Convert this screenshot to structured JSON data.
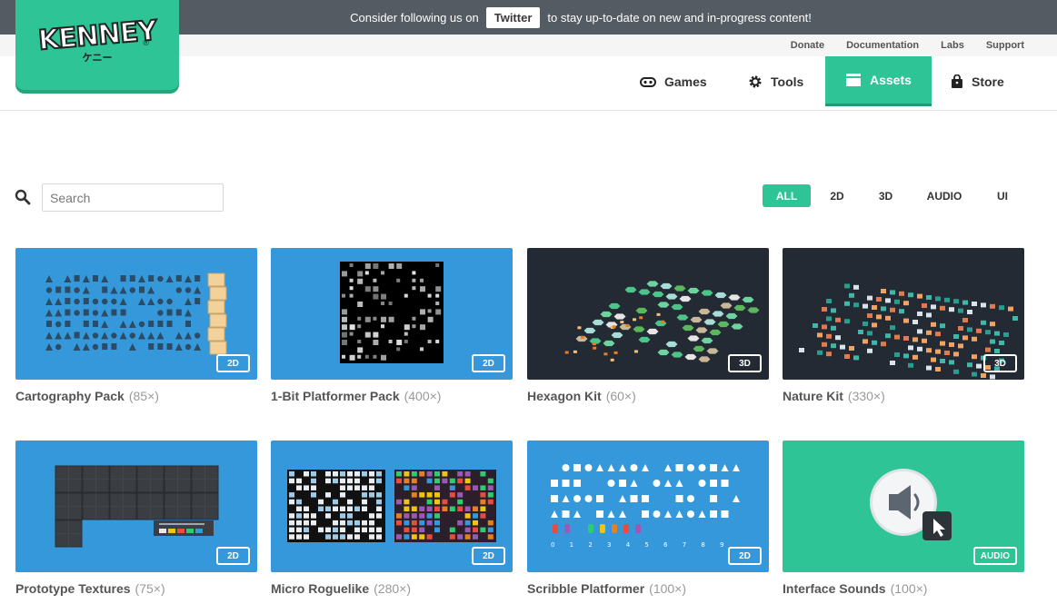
{
  "banner": {
    "text_before": "Consider following us on",
    "button": "Twitter",
    "text_after": "to stay up-to-date on new and in-progress content!"
  },
  "top_links": [
    "Donate",
    "Documentation",
    "Labs",
    "Support"
  ],
  "logo": {
    "word": "KENNEY",
    "kana": "ケニー",
    "reg": "®"
  },
  "nav": [
    {
      "label": "Games",
      "icon": "gamepad-icon"
    },
    {
      "label": "Tools",
      "icon": "gear-icon"
    },
    {
      "label": "Assets",
      "icon": "folder-icon",
      "active": true
    },
    {
      "label": "Store",
      "icon": "bag-icon"
    }
  ],
  "search": {
    "placeholder": "Search",
    "value": ""
  },
  "filters": [
    "ALL",
    "2D",
    "3D",
    "AUDIO",
    "UI"
  ],
  "filter_active": "ALL",
  "assets": [
    {
      "title": "Cartography Pack",
      "count": "(85×)",
      "badge": "2D",
      "color": "#3498db"
    },
    {
      "title": "1-Bit Platformer Pack",
      "count": "(400×)",
      "badge": "2D",
      "color": "#3498db"
    },
    {
      "title": "Hexagon Kit",
      "count": "(60×)",
      "badge": "3D",
      "color": "#232a33"
    },
    {
      "title": "Nature Kit",
      "count": "(330×)",
      "badge": "3D",
      "color": "#232a33"
    },
    {
      "title": "Prototype Textures",
      "count": "(75×)",
      "badge": "2D",
      "color": "#3498db"
    },
    {
      "title": "Micro Roguelike",
      "count": "(280×)",
      "badge": "2D",
      "color": "#3498db"
    },
    {
      "title": "Scribble Platformer",
      "count": "(100×)",
      "badge": "2D",
      "color": "#3498db"
    },
    {
      "title": "Interface Sounds",
      "count": "(100×)",
      "badge": "AUDIO",
      "color": "#2ec495"
    }
  ],
  "scribble_digits": "0 1 2 3 4 5 6 7 8 9",
  "colors": {
    "accent": "#2ec495",
    "blue": "#3498db",
    "dark": "#232a33",
    "topbar": "#545b63"
  }
}
